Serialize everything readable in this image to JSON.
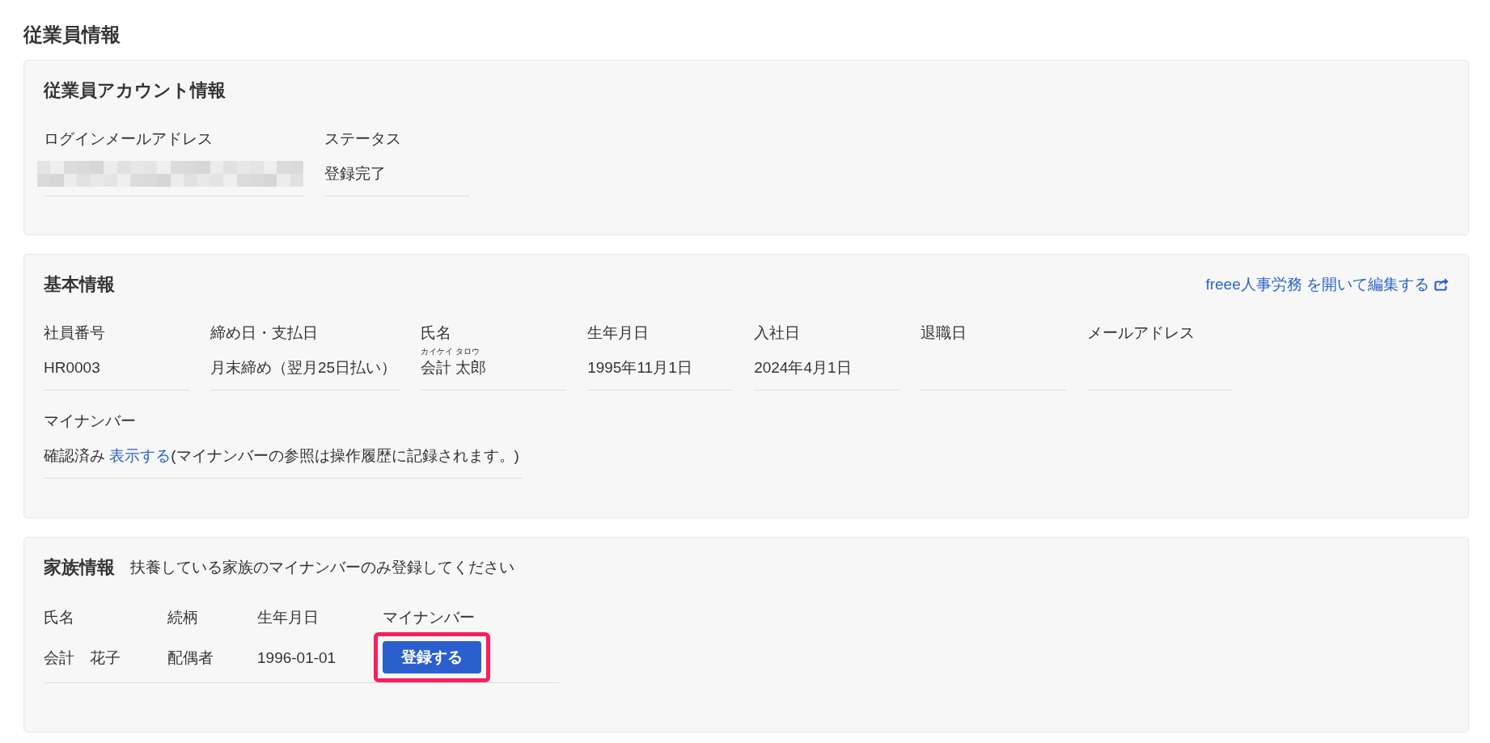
{
  "page": {
    "title": "従業員情報"
  },
  "account_section": {
    "title": "従業員アカウント情報",
    "fields": [
      {
        "kind": "redacted",
        "label": "ログインメールアドレス"
      },
      {
        "kind": "text",
        "label": "ステータス",
        "value": "登録完了"
      }
    ]
  },
  "basic_section": {
    "title": "基本情報",
    "edit_link": "freee人事労務 を開いて編集する",
    "fields": [
      {
        "kind": "text",
        "label": "社員番号",
        "value": "HR0003"
      },
      {
        "kind": "text",
        "label": "締め日・支払日",
        "value": "月末締め（翌月25日払い）"
      },
      {
        "kind": "text",
        "label": "氏名",
        "value": "会計 太郎",
        "reading": "カイケイ タロウ"
      },
      {
        "kind": "text",
        "label": "生年月日",
        "value": "1995年11月1日"
      },
      {
        "kind": "text",
        "label": "入社日",
        "value": "2024年4月1日"
      },
      {
        "kind": "text",
        "label": "退職日"
      },
      {
        "kind": "text",
        "label": "メールアドレス"
      }
    ],
    "my_number": {
      "label": "マイナンバー",
      "status": "確認済み",
      "link": "表示する",
      "note": "(マイナンバーの参照は操作履歴に記録されます。)"
    }
  },
  "family_section": {
    "title": "家族情報",
    "note": "扶養している家族のマイナンバーのみ登録してください",
    "columns": [
      "氏名",
      "続柄",
      "生年月日",
      "マイナンバー"
    ],
    "rows": [
      {
        "name": "会計　花子",
        "relation": "配偶者",
        "birth_date": "1996-01-01",
        "register_button": {
          "label": "登録する",
          "highlighted": true
        }
      }
    ]
  }
}
